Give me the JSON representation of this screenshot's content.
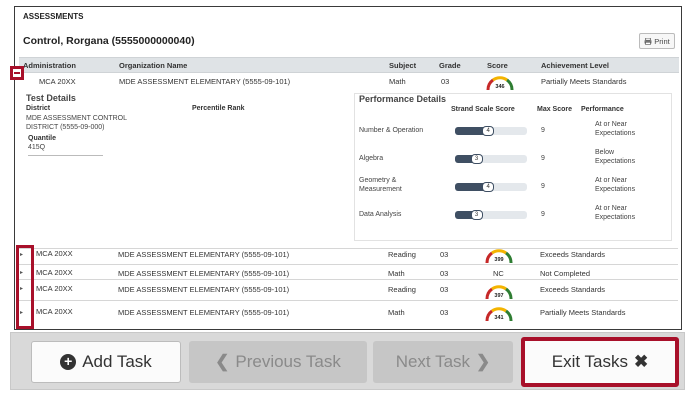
{
  "section_title": "ASSESSMENTS",
  "student_name": "Control, Rorgana (5555000000040)",
  "print_label": "Print",
  "columns": {
    "administration": "Administration",
    "organization": "Organization Name",
    "subject": "Subject",
    "grade": "Grade",
    "score": "Score",
    "achievement": "Achievement Level"
  },
  "expanded_row": {
    "administration": "MCA 20XX",
    "organization": "MDE ASSESSMENT ELEMENTARY (5555-09-101)",
    "subject": "Math",
    "grade": "03",
    "score": "346",
    "achievement": "Partially Meets Standards"
  },
  "test_details": {
    "title": "Test Details",
    "district_label": "District",
    "percentile_label": "Percentile Rank",
    "district_line1": "MDE ASSESSMENT CONTROL",
    "district_line2": "DISTRICT (5555-09-000)",
    "quantile_label": "Quantile",
    "quantile_value": "415Q"
  },
  "performance_details": {
    "title": "Performance Details",
    "col_strand": "Strand Scale Score",
    "col_max": "Max Score",
    "col_perf": "Performance",
    "strands": [
      {
        "name_line1": "Number & Operation",
        "name_line2": "",
        "score": "4",
        "fill": 0.46,
        "max": "9",
        "perf_line1": "At or Near",
        "perf_line2": "Expectations"
      },
      {
        "name_line1": "Algebra",
        "name_line2": "",
        "score": "3",
        "fill": 0.3,
        "max": "9",
        "perf_line1": "Below",
        "perf_line2": "Expectations"
      },
      {
        "name_line1": "Geometry &",
        "name_line2": "Measurement",
        "score": "4",
        "fill": 0.46,
        "max": "9",
        "perf_line1": "At or Near",
        "perf_line2": "Expectations"
      },
      {
        "name_line1": "Data Analysis",
        "name_line2": "",
        "score": "3",
        "fill": 0.3,
        "max": "9",
        "perf_line1": "At or Near",
        "perf_line2": "Expectations"
      }
    ]
  },
  "rows": [
    {
      "administration": "MCA 20XX",
      "organization": "MDE ASSESSMENT ELEMENTARY (5555-09-101)",
      "subject": "Reading",
      "grade": "03",
      "score": "399",
      "achievement": "Exceeds Standards"
    },
    {
      "administration": "MCA 20XX",
      "organization": "MDE ASSESSMENT ELEMENTARY (5555-09-101)",
      "subject": "Math",
      "grade": "03",
      "score": "NC",
      "achievement": "Not Completed"
    },
    {
      "administration": "MCA 20XX",
      "organization": "MDE ASSESSMENT ELEMENTARY (5555-09-101)",
      "subject": "Reading",
      "grade": "03",
      "score": "397",
      "achievement": "Exceeds Standards"
    },
    {
      "administration": "MCA 20XX",
      "organization": "MDE ASSESSMENT ELEMENTARY (5555-09-101)",
      "subject": "Math",
      "grade": "03",
      "score": "341",
      "achievement": "Partially Meets Standards"
    }
  ],
  "footer": {
    "add_task": "Add Task",
    "previous_task": "Previous Task",
    "next_task": "Next Task",
    "exit_tasks": "Exit Tasks"
  },
  "colors": {
    "highlight": "#a8102a",
    "bar": "#3f4f63",
    "header_bg": "#dfe3e6"
  },
  "icons": [
    "print-icon",
    "collapse-icon",
    "expand-caret-icon",
    "score-gauge-icon",
    "plus-circle-icon",
    "chevron-left-icon",
    "chevron-right-icon",
    "close-icon"
  ]
}
